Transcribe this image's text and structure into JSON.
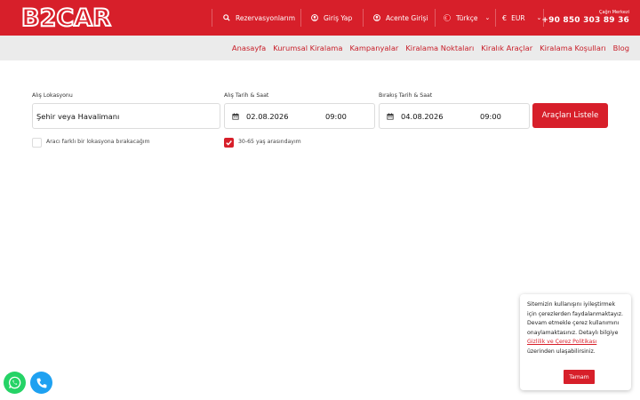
{
  "header": {
    "logo_text": "B2CAR",
    "reservations": "Rezervasyonlarım",
    "login": "Giriş Yap",
    "agency_login": "Acente Girişi",
    "language": "Türkçe",
    "currency": "EUR",
    "call_center_label": "Çağrı Merkezi",
    "phone": "+90 850 303 89 36"
  },
  "nav": {
    "items": [
      "Anasayfa",
      "Kurumsal Kiralama",
      "Kampanyalar",
      "Kiralama Noktaları",
      "Kiralık Araçlar",
      "Kiralama Koşulları",
      "Blog"
    ]
  },
  "search": {
    "pickup_location_label": "Alış Lokasyonu",
    "pickup_location_value": "Şehir veya Havalimanı",
    "pickup_datetime_label": "Alış Tarih & Saat",
    "pickup_date": "02.08.2026",
    "pickup_time": "09:00",
    "return_datetime_label": "Bırakış Tarih & Saat",
    "return_date": "04.08.2026",
    "return_time": "09:00",
    "submit_label": "Araçları Listele",
    "different_return_label": "Aracı farklı bir lokasyona bırakacağım",
    "different_return_checked": false,
    "age_label": "30-65 yaş arasındayım",
    "age_checked": true
  },
  "cookie": {
    "text_before": "Sitemizin kullanışını iyileştirmek için çerezlerden faydalanmaktayız. Devam etmekle çerez kullanımını onaylamaktasınız. Detaylı bilgiye ",
    "link_text": "Gizlilik ve Çerez Politikası",
    "text_after": " üzerinden ulaşabilirsiniz.",
    "accept_label": "Tamam"
  },
  "colors": {
    "brand_red": "#d71f2a",
    "nav_bg": "#ebebeb",
    "whatsapp_green": "#25d366",
    "phone_blue": "#1ea1f1"
  },
  "icons": {
    "reservations": "search-icon",
    "login": "user-icon",
    "agency": "user-icon",
    "language": "flag-icon",
    "currency": "euro-icon",
    "date": "calendar-icon",
    "whatsapp": "whatsapp-icon",
    "phone": "phone-icon"
  }
}
